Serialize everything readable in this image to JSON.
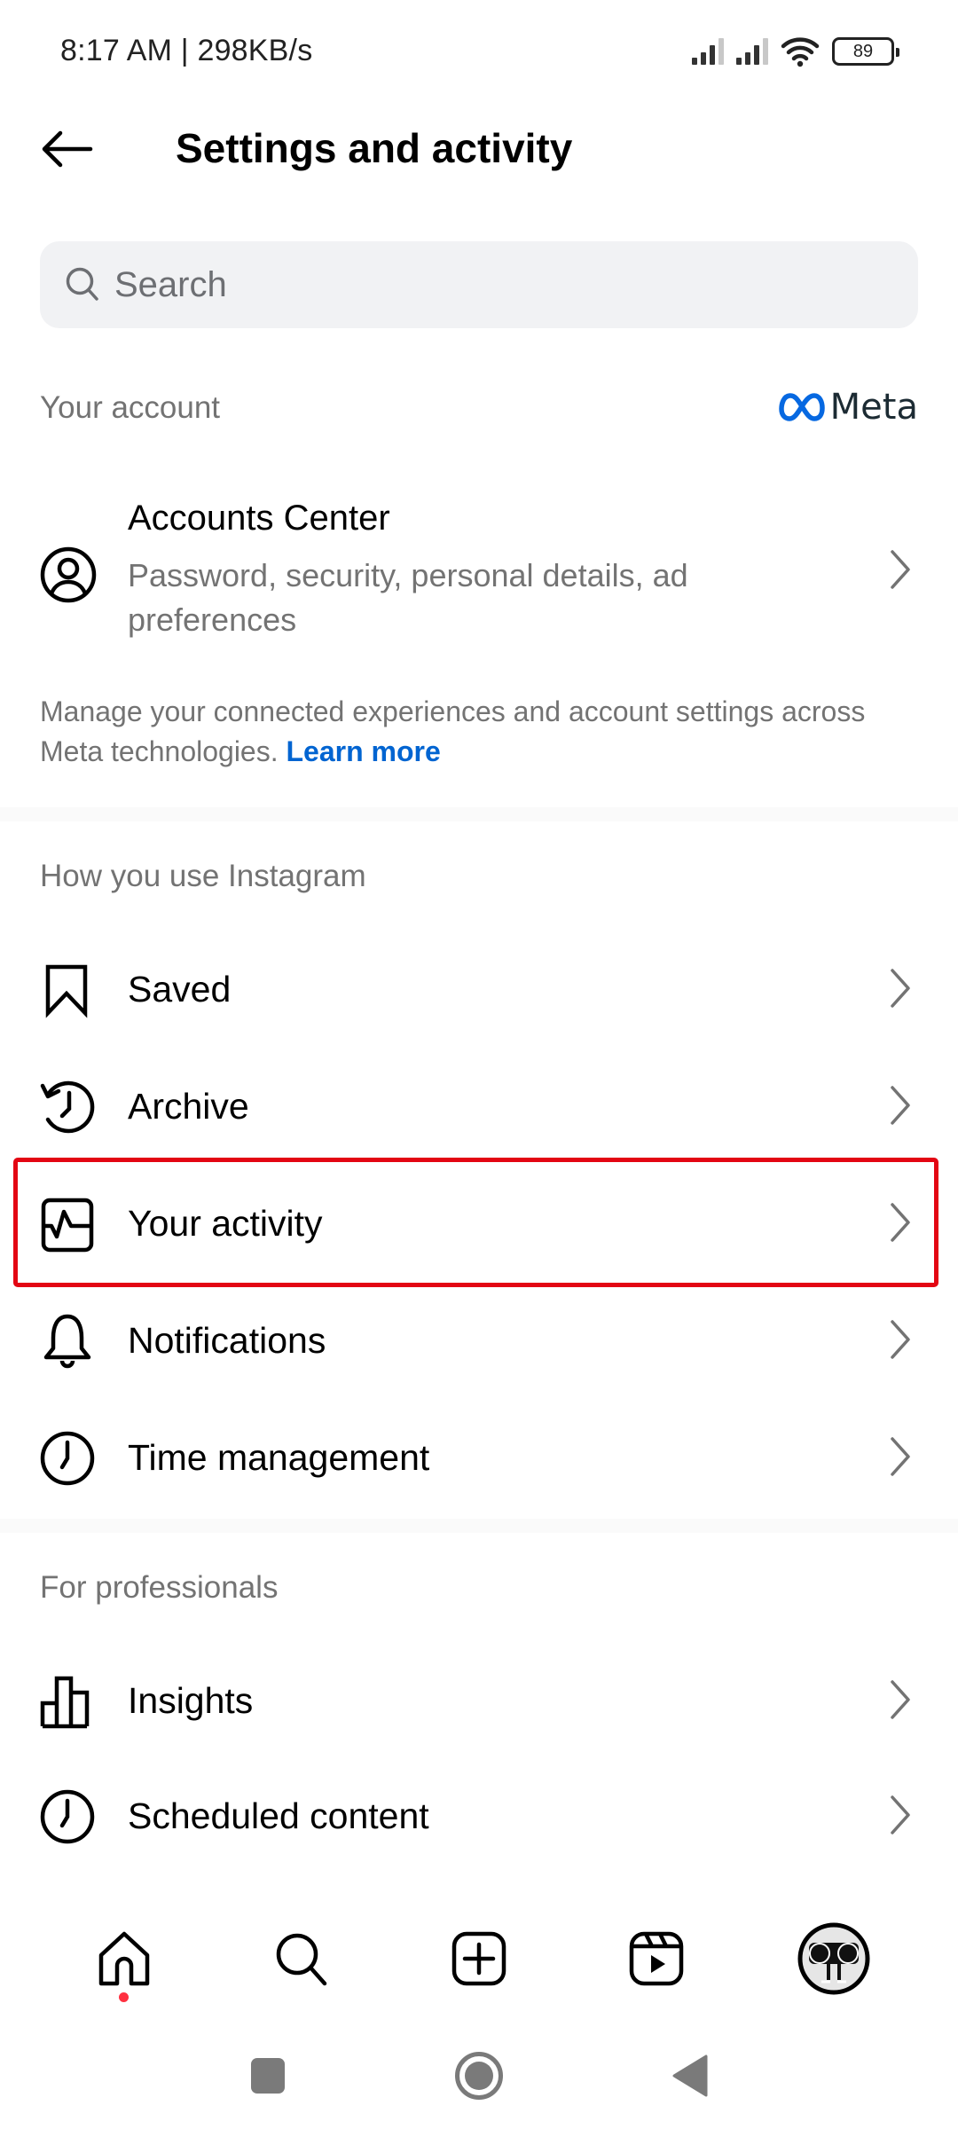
{
  "status_bar": {
    "time_speed": "8:17 AM | 298KB/s",
    "battery": "89",
    "icons": [
      "signal-1-icon",
      "signal-2-icon",
      "wifi-icon",
      "battery-icon"
    ]
  },
  "header": {
    "back_icon": "arrow-left-icon",
    "title": "Settings and activity"
  },
  "search": {
    "placeholder": "Search",
    "value": "",
    "icon": "search-icon"
  },
  "your_account": {
    "label": "Your account",
    "brand": "Meta",
    "brand_color": "#0668E1",
    "accounts_center": {
      "title": "Accounts Center",
      "subtitle": "Password, security, personal details, ad preferences",
      "icon": "user-circle-icon"
    },
    "manage_text": "Manage your connected experiences and account settings across Meta technologies.",
    "learn_more": "Learn more",
    "link_color": "#0064D1"
  },
  "how_you_use": {
    "label": "How you use Instagram",
    "items": [
      {
        "label": "Saved",
        "icon": "bookmark-icon"
      },
      {
        "label": "Archive",
        "icon": "archive-history-icon"
      },
      {
        "label": "Your activity",
        "icon": "activity-icon",
        "highlighted": true
      },
      {
        "label": "Notifications",
        "icon": "bell-icon"
      },
      {
        "label": "Time management",
        "icon": "clock-icon"
      }
    ]
  },
  "for_professionals": {
    "label": "For professionals",
    "items": [
      {
        "label": "Insights",
        "icon": "bar-chart-icon"
      },
      {
        "label": "Scheduled content",
        "icon": "clock-icon"
      }
    ]
  },
  "highlight_color": "#E30613",
  "bottom_nav": [
    {
      "name": "home",
      "icon": "home-icon",
      "has_notification": true
    },
    {
      "name": "search",
      "icon": "search-icon"
    },
    {
      "name": "create",
      "icon": "plus-square-icon"
    },
    {
      "name": "reels",
      "icon": "reels-icon"
    },
    {
      "name": "profile",
      "icon": "avatar"
    }
  ],
  "system_nav": [
    "recents-button",
    "home-button",
    "back-button"
  ]
}
